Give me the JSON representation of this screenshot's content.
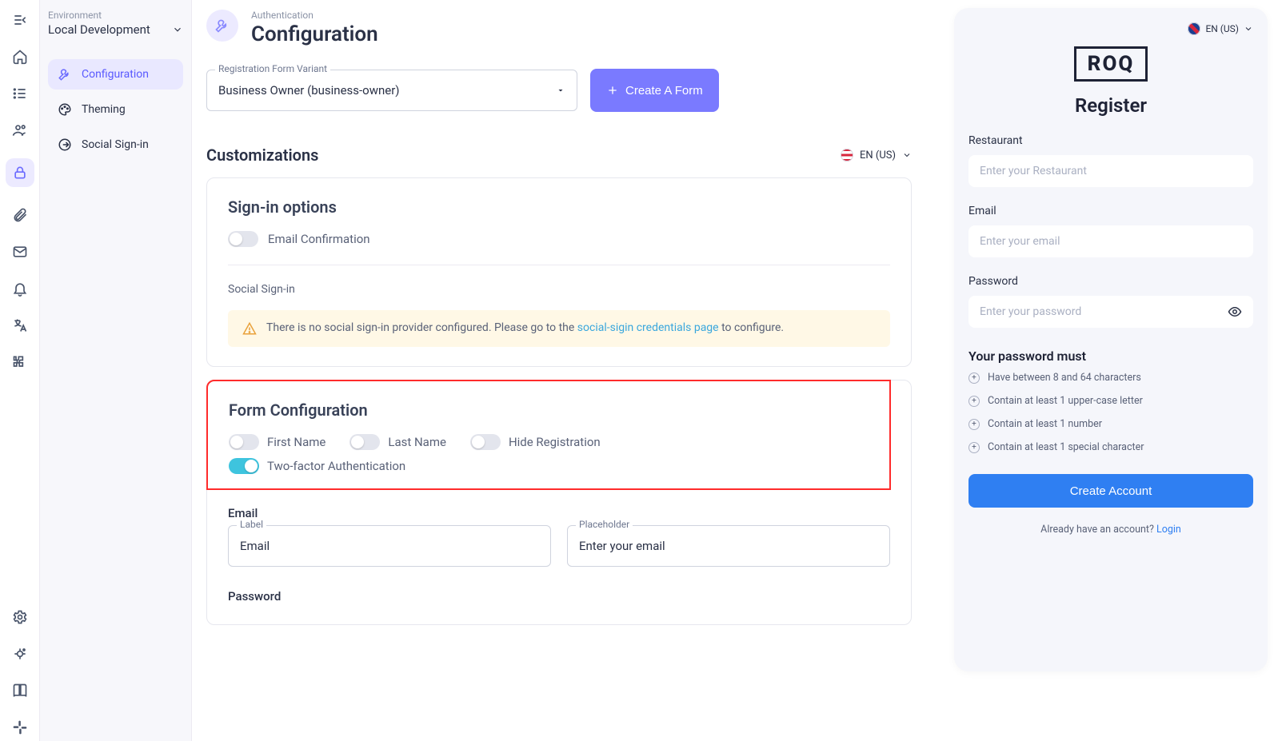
{
  "env": {
    "label": "Environment",
    "value": "Local Development"
  },
  "subnav": {
    "configuration": "Configuration",
    "theming": "Theming",
    "social": "Social Sign-in"
  },
  "page": {
    "breadcrumb": "Authentication",
    "title": "Configuration"
  },
  "variant": {
    "label": "Registration Form Variant",
    "value": "Business Owner (business-owner)"
  },
  "createFormBtn": "Create A Form",
  "customizations": "Customizations",
  "langMain": "EN (US)",
  "signin": {
    "title": "Sign-in options",
    "emailConfirm": "Email Confirmation",
    "socialTitle": "Social Sign-in",
    "alertPrefix": "There is no social sign-in provider configured. Please go to the ",
    "alertLink": "social-sigin credentials page",
    "alertSuffix": " to configure."
  },
  "formcfg": {
    "title": "Form Configuration",
    "first": "First Name",
    "last": "Last Name",
    "hide": "Hide Registration",
    "twofa": "Two-factor Authentication",
    "emailSection": "Email",
    "labelField": "Label",
    "labelValue": "Email",
    "placeholderField": "Placeholder",
    "placeholderValue": "Enter your email",
    "passwordSection": "Password"
  },
  "preview": {
    "lang": "EN (US)",
    "logo": "ROQ",
    "title": "Register",
    "restaurantLabel": "Restaurant",
    "restaurantPh": "Enter your Restaurant",
    "emailLabel": "Email",
    "emailPh": "Enter your email",
    "passwordLabel": "Password",
    "passwordPh": "Enter your password",
    "pwTitle": "Your password must",
    "rules": [
      "Have between 8 and 64 characters",
      "Contain at least 1 upper-case letter",
      "Contain at least 1 number",
      "Contain at least 1 special character"
    ],
    "createBtn": "Create Account",
    "already": "Already have an account? ",
    "login": "Login"
  }
}
